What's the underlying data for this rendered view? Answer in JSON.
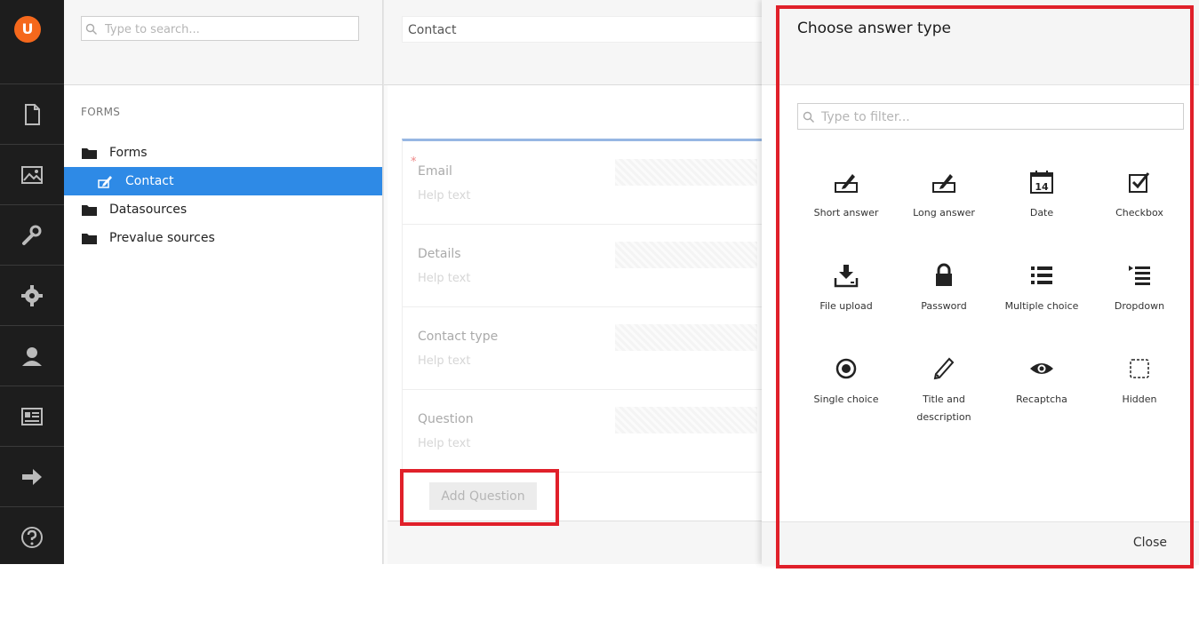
{
  "app": {
    "logo": "U",
    "sections": [
      {
        "icon": "content-icon"
      },
      {
        "icon": "media-icon"
      },
      {
        "icon": "settings-wrench-icon"
      },
      {
        "icon": "developer-gear-icon"
      },
      {
        "icon": "users-icon"
      },
      {
        "icon": "members-card-icon"
      },
      {
        "icon": "forms-arrow-icon"
      },
      {
        "icon": "help-icon"
      }
    ]
  },
  "tree": {
    "search_placeholder": "Type to search...",
    "section_title": "FORMS",
    "items": [
      {
        "label": "Forms",
        "icon": "folder-icon"
      },
      {
        "label": "Contact",
        "icon": "form-edit-icon",
        "selected": true
      },
      {
        "label": "Datasources",
        "icon": "folder-icon"
      },
      {
        "label": "Prevalue sources",
        "icon": "folder-icon"
      }
    ]
  },
  "editor": {
    "form_name": "Contact",
    "required_marker": "*",
    "fields": [
      {
        "label": "Email",
        "help": "Help text"
      },
      {
        "label": "Details",
        "help": "Help text"
      },
      {
        "label": "Contact type",
        "help": "Help text"
      },
      {
        "label": "Question",
        "help": "Help text"
      }
    ],
    "add_question_label": "Add Question"
  },
  "dialog": {
    "title": "Choose answer type",
    "filter_placeholder": "Type to filter...",
    "types": [
      {
        "label": "Short answer",
        "icon": "short-answer-icon"
      },
      {
        "label": "Long answer",
        "icon": "long-answer-icon"
      },
      {
        "label": "Date",
        "icon": "calendar-icon",
        "day": "14"
      },
      {
        "label": "Checkbox",
        "icon": "checkbox-icon"
      },
      {
        "label": "File upload",
        "icon": "file-upload-icon"
      },
      {
        "label": "Password",
        "icon": "lock-icon"
      },
      {
        "label": "Multiple choice",
        "icon": "list-icon"
      },
      {
        "label": "Dropdown",
        "icon": "dropdown-list-icon"
      },
      {
        "label": "Single choice",
        "icon": "radio-icon"
      },
      {
        "label": "Title and description",
        "icon": "pencil-icon"
      },
      {
        "label": "Recaptcha",
        "icon": "eye-icon"
      },
      {
        "label": "Hidden",
        "icon": "hidden-dashed-icon"
      }
    ],
    "close_label": "Close"
  },
  "colors": {
    "appbar": "#1d1d1d",
    "logo": "#f5681c",
    "selected": "#2e8ae6",
    "highlight": "#e0202a"
  }
}
